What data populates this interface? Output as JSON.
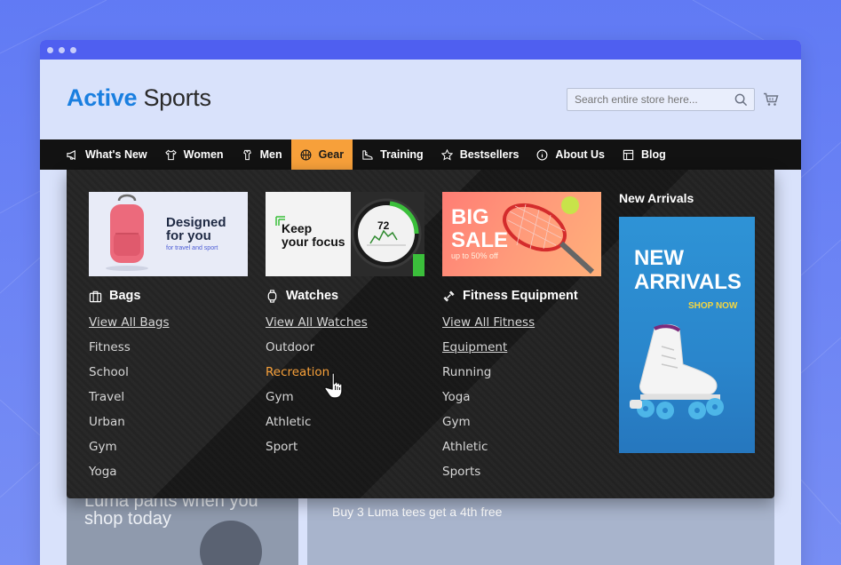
{
  "brand": {
    "name_strong": "Active",
    "name_light": "Sports",
    "accent_color": "#1a7fe0"
  },
  "search": {
    "placeholder": "Search entire store here..."
  },
  "nav": {
    "items": [
      {
        "label": "What's New",
        "icon": "megaphone-icon"
      },
      {
        "label": "Women",
        "icon": "tshirt-icon"
      },
      {
        "label": "Men",
        "icon": "shirt-icon"
      },
      {
        "label": "Gear",
        "icon": "basketball-icon",
        "active": true
      },
      {
        "label": "Training",
        "icon": "shoe-icon"
      },
      {
        "label": "Bestsellers",
        "icon": "star-icon"
      },
      {
        "label": "About Us",
        "icon": "info-icon"
      },
      {
        "label": "Blog",
        "icon": "layout-icon"
      }
    ],
    "active_color": "#f7a03a"
  },
  "mega_menu": {
    "columns": [
      {
        "heading": "Bags",
        "icon": "bag-icon",
        "banner": {
          "line1": "Designed",
          "line2": "for you",
          "sub": "for travel and sport"
        },
        "items": [
          "View All Bags",
          "Fitness",
          "School",
          "Travel",
          "Urban",
          "Gym",
          "Yoga"
        ]
      },
      {
        "heading": "Watches",
        "icon": "watch-icon",
        "banner": {
          "line1": "Keep",
          "line2": "your focus",
          "watch_number": "72"
        },
        "items": [
          "View All Watches",
          "Outdoor",
          "Recreation",
          "Gym",
          "Athletic",
          "Sport"
        ]
      },
      {
        "heading": "Fitness Equipment",
        "icon": "dumbbell-icon",
        "banner": {
          "line1": "BIG",
          "line2": "SALE",
          "sub": "up to 50% off"
        },
        "items": [
          "View All Fitness Equipment",
          "Running",
          "Yoga",
          "Gym",
          "Athletic",
          "Sports"
        ]
      }
    ],
    "highlighted_item": "Recreation",
    "new_arrivals": {
      "title": "New Arrivals",
      "banner_line1": "NEW",
      "banner_line2": "ARRIVALS",
      "banner_cta": "SHOP NOW"
    }
  },
  "page_behind": {
    "promo_left": "Luma pants when you shop today",
    "promo_right": "Buy 3 Luma tees get a 4th free"
  }
}
